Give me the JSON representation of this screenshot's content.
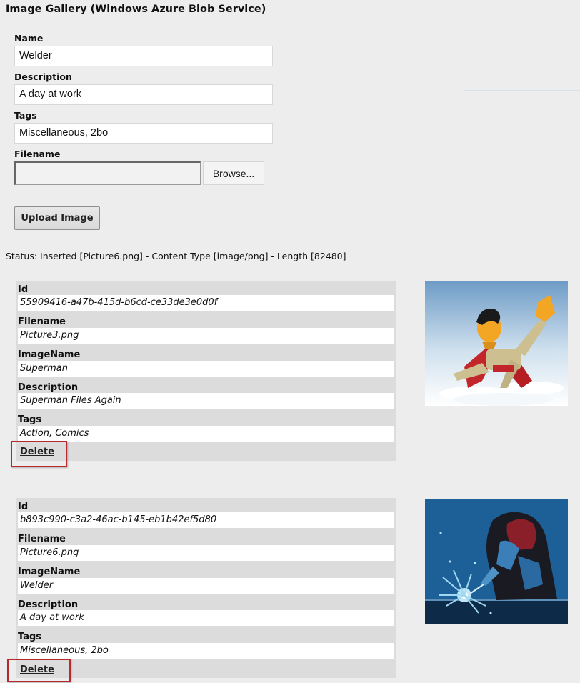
{
  "page": {
    "title": "Image Gallery (Windows Azure Blob Service)"
  },
  "form": {
    "name_label": "Name",
    "name_value": "Welder",
    "description_label": "Description",
    "description_value": "A day at work",
    "tags_label": "Tags",
    "tags_value": "Miscellaneous, 2bo",
    "filename_label": "Filename",
    "browse_label": "Browse...",
    "upload_label": "Upload Image"
  },
  "status": "Status: Inserted [Picture6.png] - Content Type [image/png] - Length [82480]",
  "field_labels": {
    "id": "Id",
    "filename": "Filename",
    "imagename": "ImageName",
    "description": "Description",
    "tags": "Tags"
  },
  "images": [
    {
      "id": "55909416-a47b-415d-b6cd-ce33de3e0d0f",
      "filename": "Picture3.png",
      "imagename": "Superman",
      "description": "Superman Files Again",
      "tags": "Action, Comics",
      "delete_label": "Delete",
      "thumbnail": "superhero-flying-clipart"
    },
    {
      "id": "b893c990-c3a2-46ac-b145-eb1b42ef5d80",
      "filename": "Picture6.png",
      "imagename": "Welder",
      "description": "A day at work",
      "tags": "Miscellaneous, 2bo",
      "delete_label": "Delete",
      "thumbnail": "welder-sparks-clipart"
    }
  ],
  "colors": {
    "page_bg": "#ededed",
    "card_bg": "#dcdcdc",
    "highlight_border": "#b52a2a"
  }
}
